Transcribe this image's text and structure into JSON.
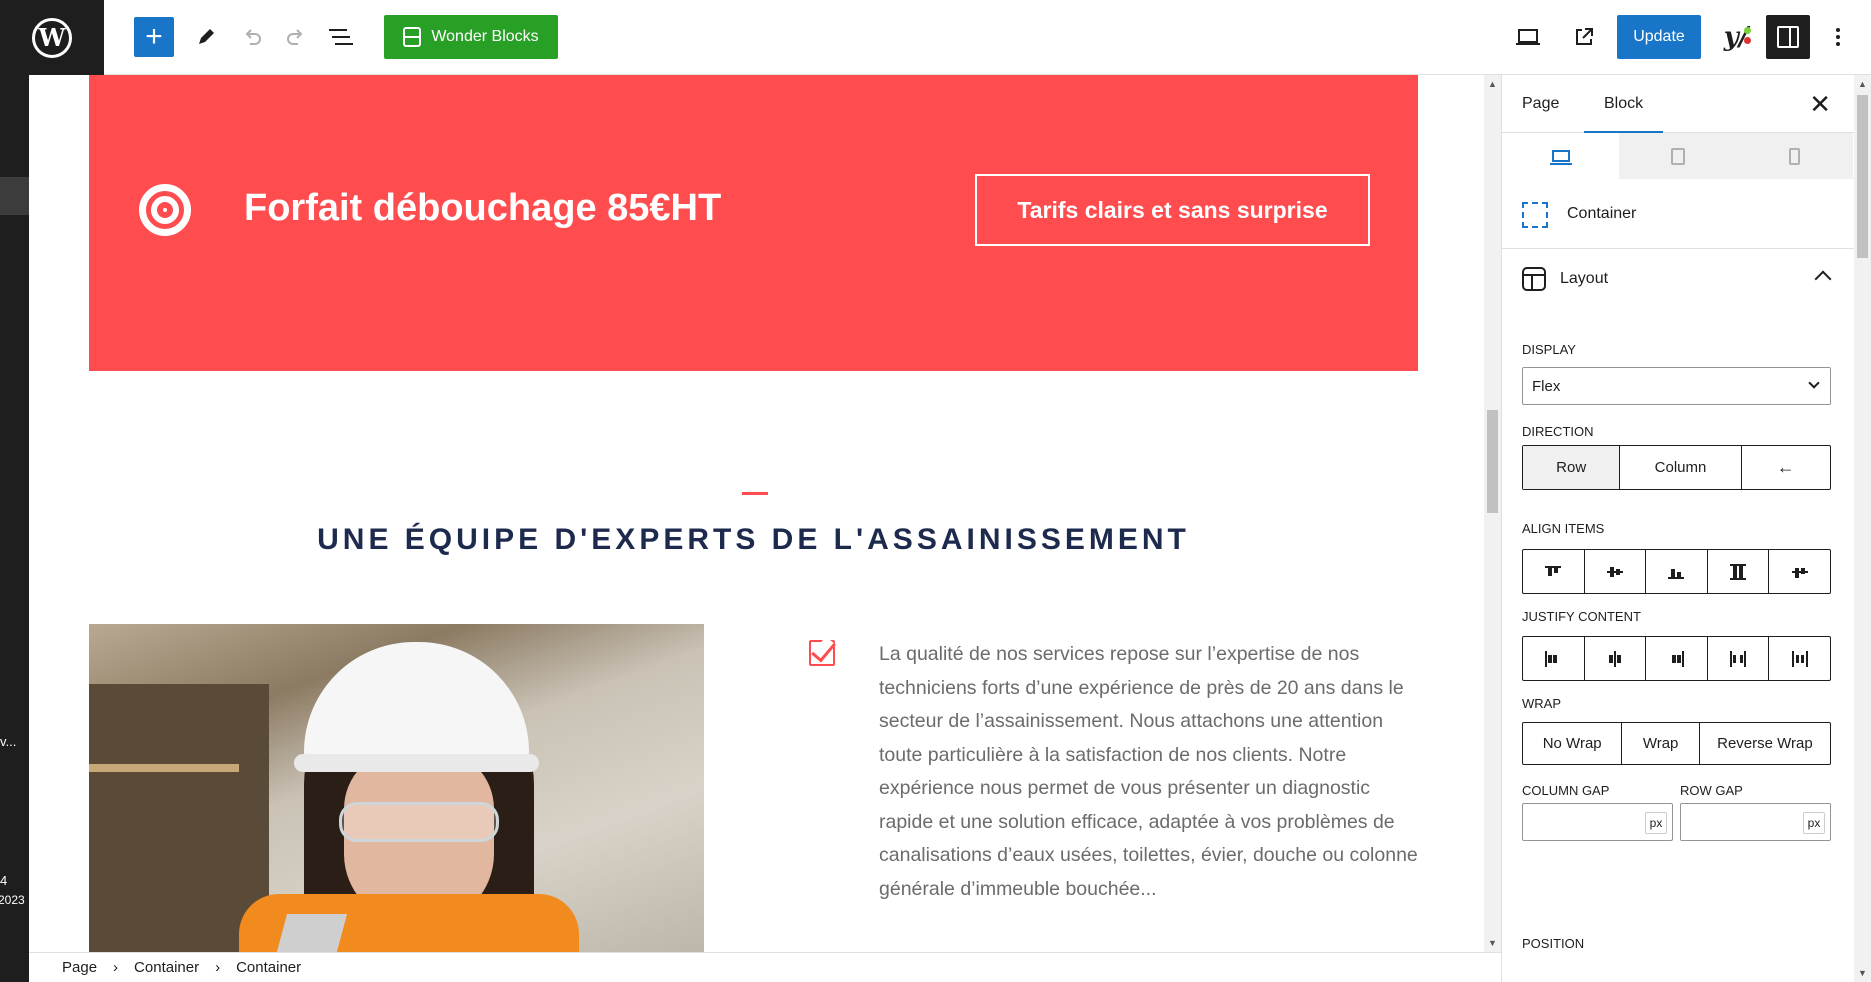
{
  "toolbar": {
    "wp_logo": "W",
    "add_label": "+",
    "wonder_blocks_label": "Wonder Blocks",
    "update_label": "Update",
    "yoast_label": "y/",
    "colors": {
      "primary": "#1875c8",
      "wonder": "#28a025",
      "yoast_green": "#7ad03a",
      "yoast_red": "#dc3232"
    }
  },
  "left_strip": {
    "texts": [
      "v...",
      "4",
      "2023"
    ]
  },
  "banner": {
    "title": "Forfait débouchage 85€HT",
    "cta": "Tarifs clairs et sans surprise",
    "color": "#fe4c4f"
  },
  "section": {
    "title": "UNE ÉQUIPE D'EXPERTS DE L'ASSAINISSEMENT",
    "paragraph": "La qualité de nos services repose sur l’expertise de nos techniciens forts d’une expérience de près de 20 ans dans le secteur de l’assainissement.  Nous attachons une attention toute particulière à la satisfaction de nos clients. Notre expérience nous permet de vous présenter un diagnostic rapide et une solution efficace, adaptée à vos problèmes de canalisations d’eaux usées, toilettes, évier, douche ou colonne générale d’immeuble bouchée..."
  },
  "breadcrumb": [
    "Page",
    "Container",
    "Container"
  ],
  "panel": {
    "tabs": [
      "Page",
      "Block"
    ],
    "active_tab": "Block",
    "close": "✕",
    "block_name": "Container",
    "layout_title": "Layout",
    "display_label": "DISPLAY",
    "display_value": "Flex",
    "direction_label": "DIRECTION",
    "direction_options": [
      "Row",
      "Column",
      "←"
    ],
    "direction_selected": "Row",
    "align_items_label": "ALIGN ITEMS",
    "justify_content_label": "JUSTIFY CONTENT",
    "wrap_label": "WRAP",
    "wrap_options": [
      "No Wrap",
      "Wrap",
      "Reverse Wrap"
    ],
    "column_gap_label": "COLUMN GAP",
    "row_gap_label": "ROW GAP",
    "unit": "px",
    "position_label": "POSITION"
  }
}
